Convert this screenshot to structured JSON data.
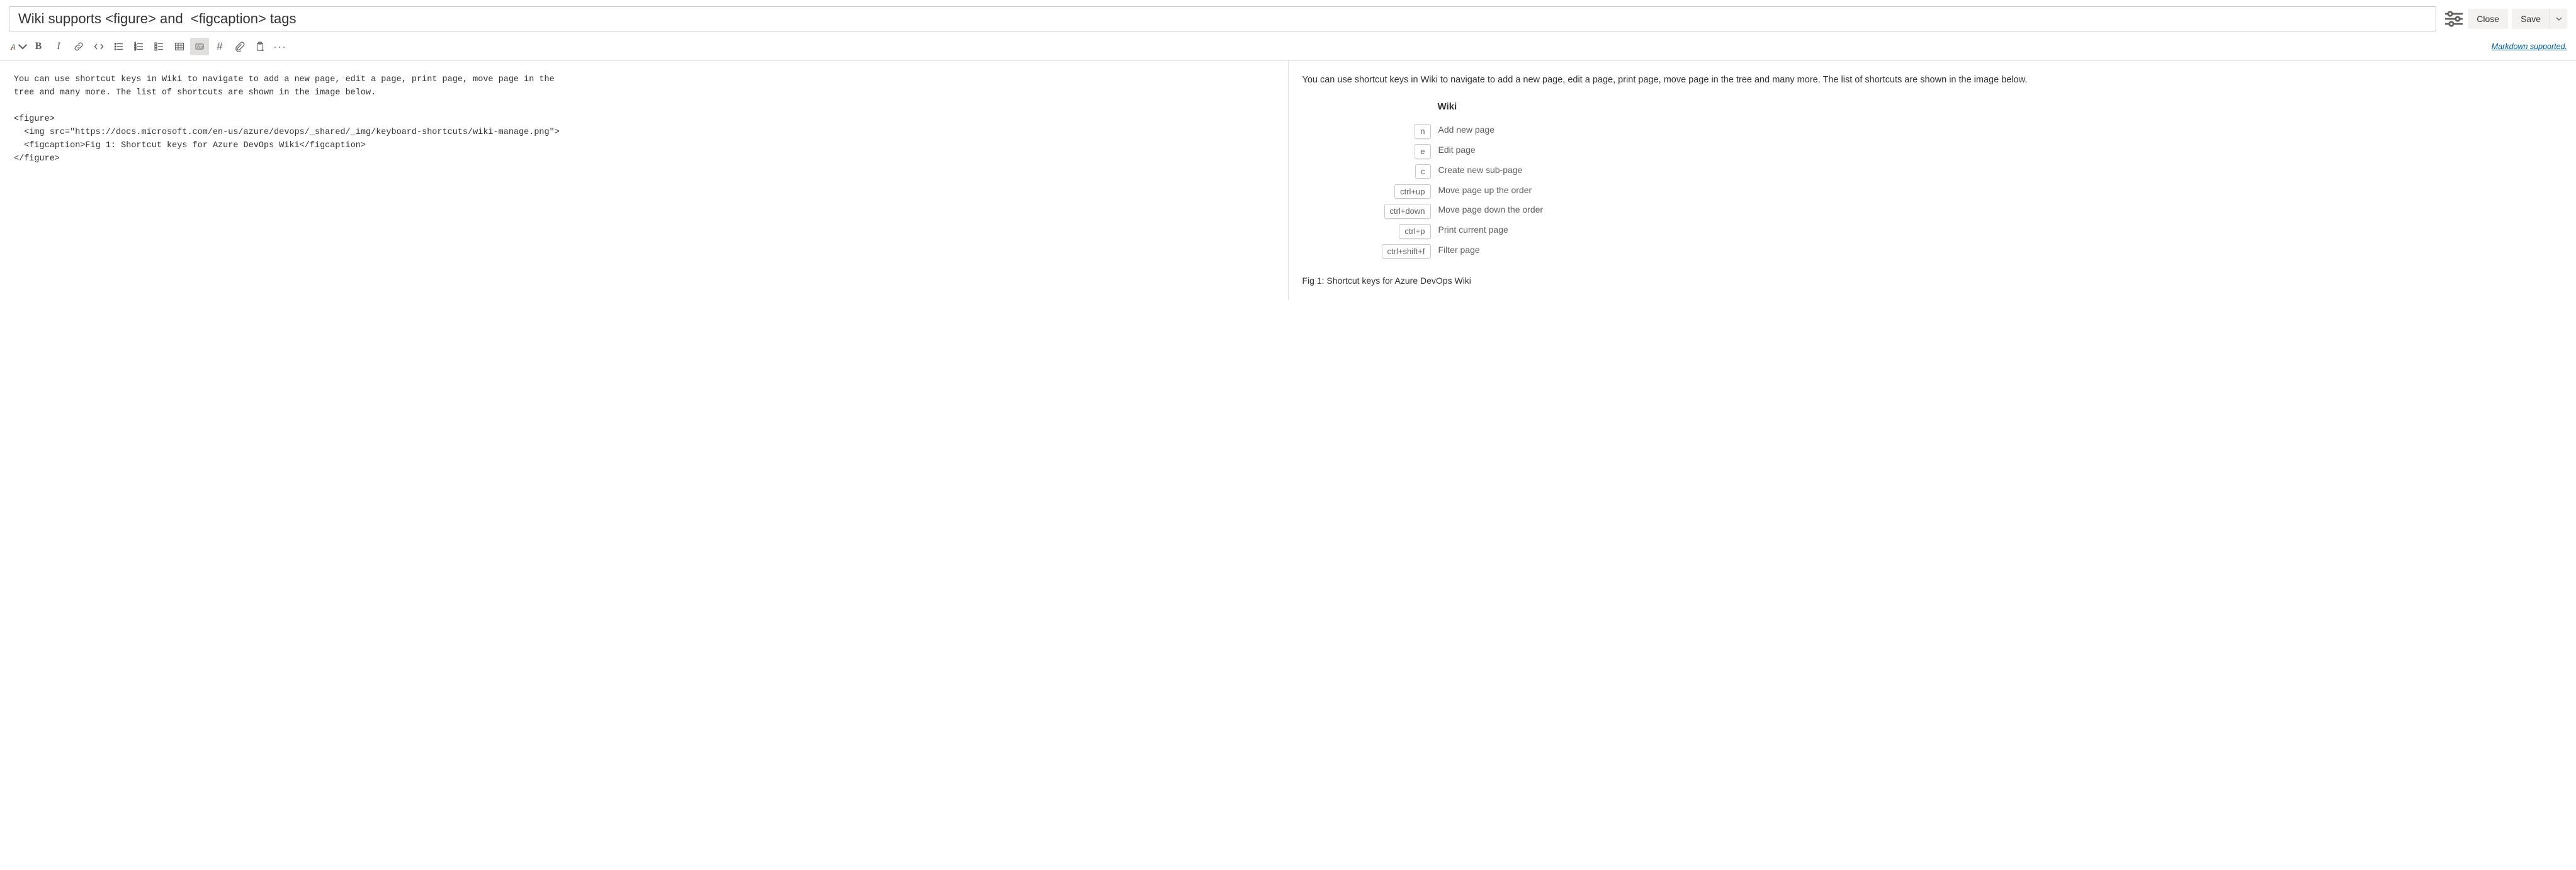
{
  "header": {
    "title_value": "Wiki supports <figure> and  <figcaption> tags",
    "close_label": "Close",
    "save_label": "Save",
    "markdown_link": "Markdown supported."
  },
  "editor": {
    "raw": "You can use shortcut keys in Wiki to navigate to add a new page, edit a page, print page, move page in the\ntree and many more. The list of shortcuts are shown in the image below.\n\n<figure>\n  <img src=\"https://docs.microsoft.com/en-us/azure/devops/_shared/_img/keyboard-shortcuts/wiki-manage.png\">\n  <figcaption>Fig 1: Shortcut keys for Azure DevOps Wiki</figcaption>\n</figure>"
  },
  "preview": {
    "paragraph": "You can use shortcut keys in Wiki to navigate to add a new page, edit a page, print page, move page in the tree and many more. The list of shortcuts are shown in the image below.",
    "shortcuts_title": "Wiki",
    "shortcuts": [
      {
        "key": "n",
        "desc": "Add new page"
      },
      {
        "key": "e",
        "desc": "Edit page"
      },
      {
        "key": "c",
        "desc": "Create new sub-page"
      },
      {
        "key": "ctrl+up",
        "desc": "Move page up the order"
      },
      {
        "key": "ctrl+down",
        "desc": "Move page down the order"
      },
      {
        "key": "ctrl+p",
        "desc": "Print current page"
      },
      {
        "key": "ctrl+shift+f",
        "desc": "Filter page"
      }
    ],
    "figcaption": "Fig 1: Shortcut keys for Azure DevOps Wiki"
  }
}
